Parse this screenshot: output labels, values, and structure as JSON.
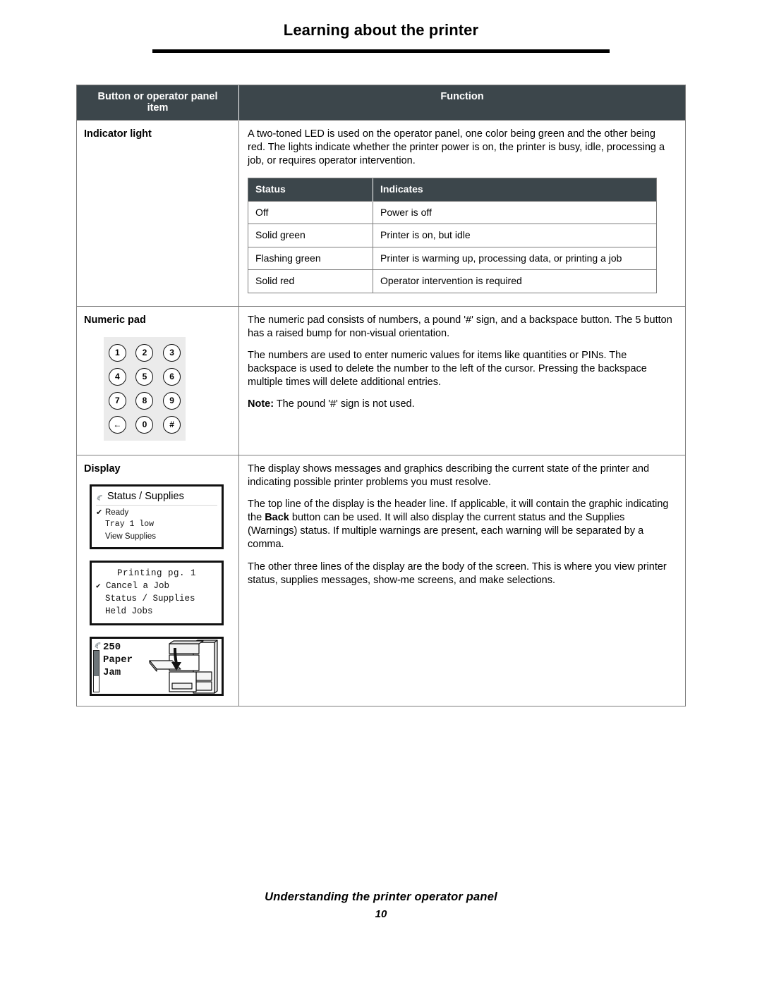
{
  "page": {
    "title": "Learning about the printer",
    "footer_title": "Understanding the printer operator panel",
    "footer_page_number": "10",
    "accent_header_bg": "#3c464b",
    "border_color": "#7d7d7d"
  },
  "table": {
    "headers": {
      "col1_line1": "Button or operator panel",
      "col1_line2": "item",
      "col2": "Function"
    },
    "rows": [
      {
        "label": "Indicator light",
        "paragraphs": [
          "A two-toned LED is used on the operator panel, one color being green and the other being red. The lights indicate whether the printer power is on, the printer is busy, idle, processing a job, or requires operator intervention."
        ],
        "status_table": {
          "headers": [
            "Status",
            "Indicates"
          ],
          "rows": [
            [
              "Off",
              "Power is off"
            ],
            [
              "Solid green",
              "Printer is on, but idle"
            ],
            [
              "Flashing green",
              "Printer is warming up, processing data, or printing a job"
            ],
            [
              "Solid red",
              "Operator intervention is required"
            ]
          ]
        }
      },
      {
        "label": "Numeric pad",
        "paragraphs": [
          "The numeric pad consists of numbers, a pound '#' sign, and a backspace button. The 5 button has a raised bump for non-visual orientation.",
          "The numbers are used to enter numeric values for items like quantities or PINs. The backspace is used to delete the number to the left of the cursor. Pressing the backspace multiple times will delete additional entries."
        ],
        "note_label": "Note:",
        "note_text": " The pound '#' sign is not used.",
        "keypad": {
          "rows": [
            [
              "1",
              "2",
              "3"
            ],
            [
              "4",
              "5",
              "6"
            ],
            [
              "7",
              "8",
              "9"
            ],
            [
              "←",
              "0",
              "#"
            ]
          ]
        }
      },
      {
        "label": "Display",
        "paragraphs": [
          "The display shows messages and graphics describing the current state of the printer and indicating possible printer problems you must resolve."
        ],
        "paragraph2": {
          "before": "The top line of the display is the header line. If applicable, it will contain the graphic indicating the ",
          "bold": "Back",
          "after": " button can be used. It will also display the current status and the Supplies (Warnings) status. If multiple warnings are present, each warning will be separated by a comma."
        },
        "paragraph3": "The other three lines of the display are the body of the screen. This is where you view printer status, supplies messages, show-me screens, and make selections.",
        "lcd_screens": [
          {
            "header": "Status / Supplies",
            "line1_check": "✔",
            "line1": "Ready",
            "line2": "Tray 1 low",
            "line3": "View Supplies"
          },
          {
            "header": "Printing pg. 1",
            "line1_check": "✔",
            "line1": "Cancel a Job",
            "line2": "Status / Supplies",
            "line3": "Held Jobs"
          },
          {
            "line1": "250",
            "line2": "Paper",
            "line3": "Jam"
          }
        ]
      }
    ]
  }
}
